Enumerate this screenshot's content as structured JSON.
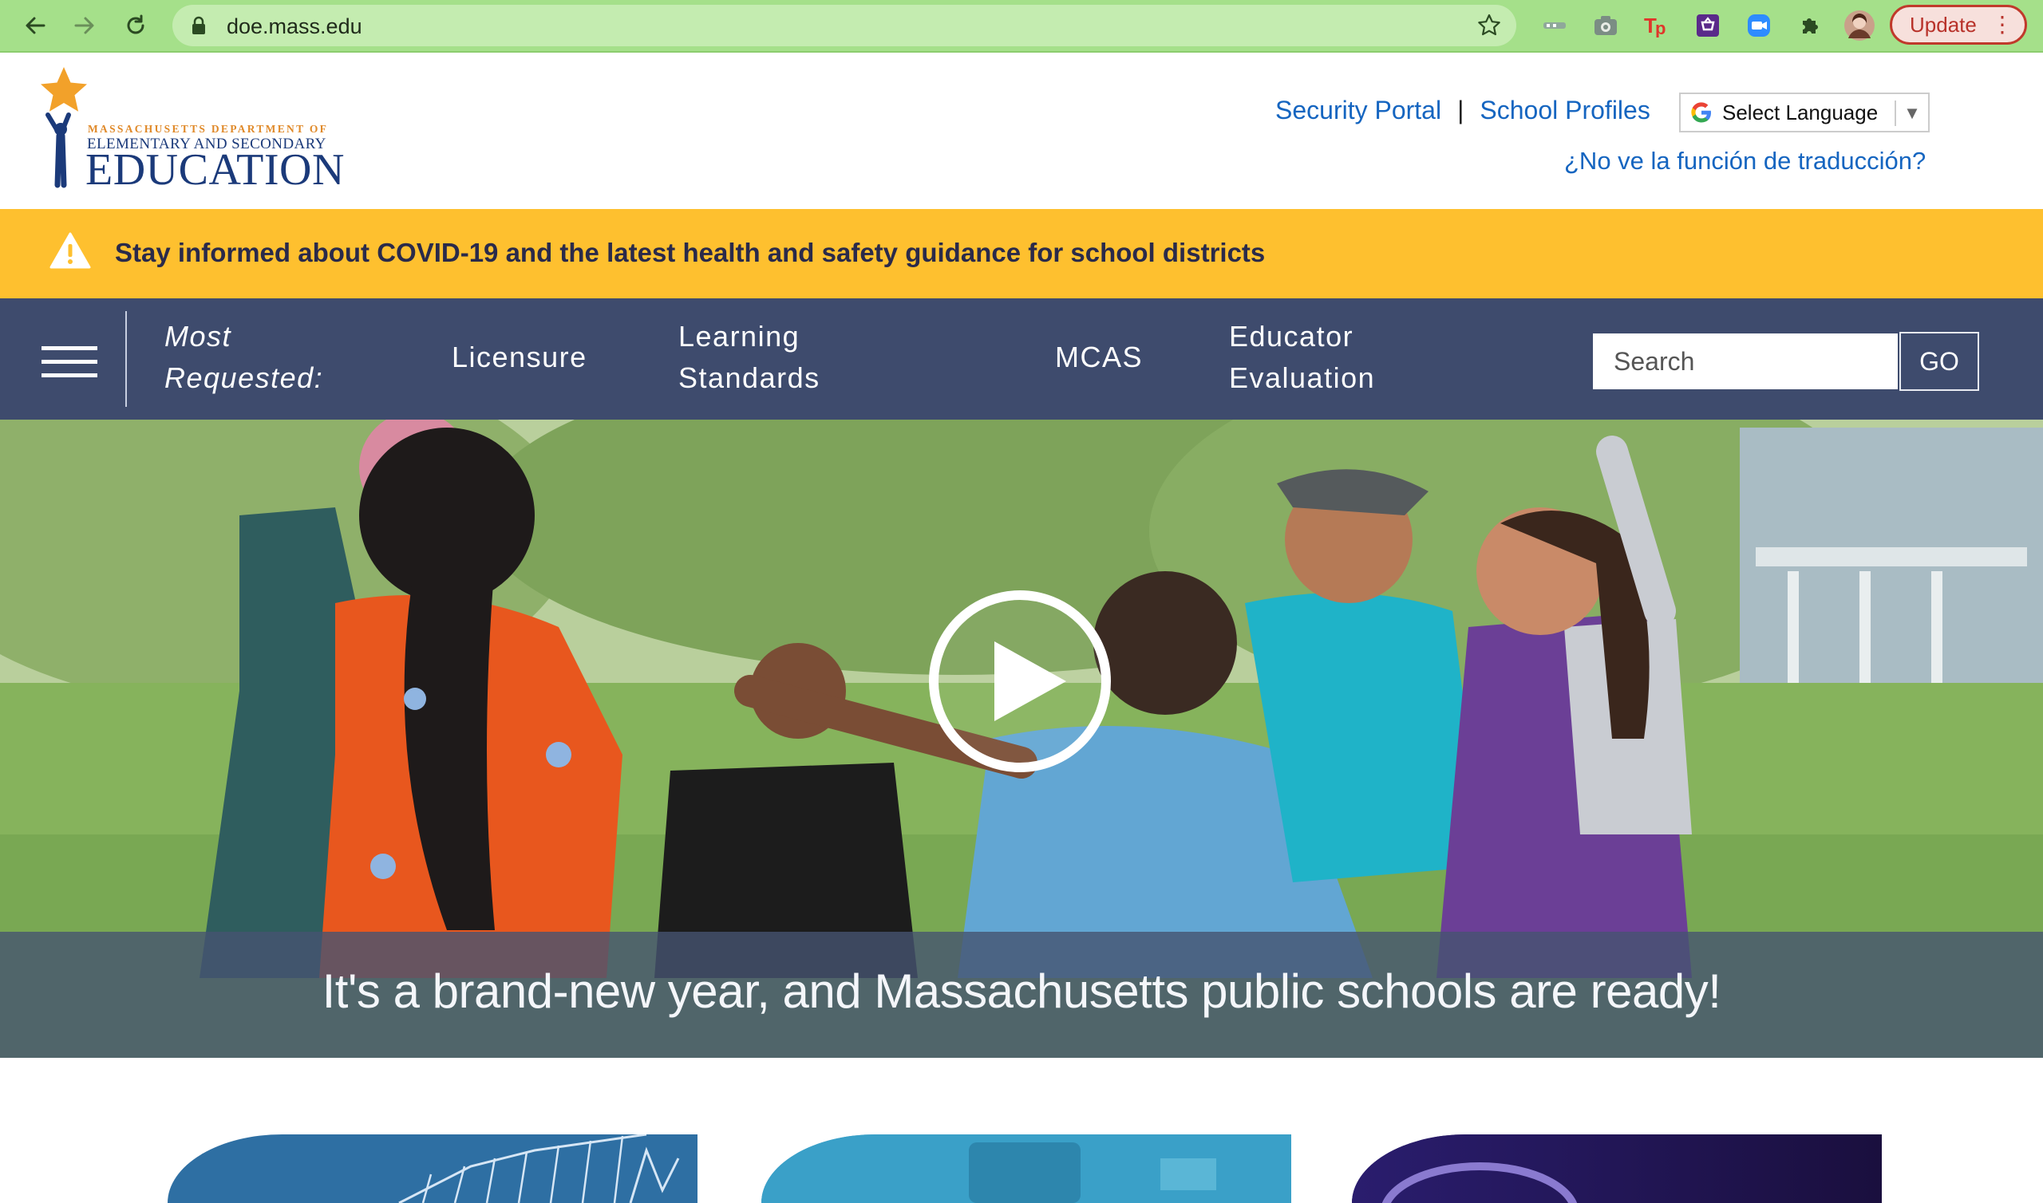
{
  "browser": {
    "url": "doe.mass.edu",
    "update_label": "Update",
    "extensions": [
      "key-icon",
      "camera-icon",
      "tp-icon",
      "shopping-icon",
      "zoom-icon",
      "puzzle-icon",
      "profile-avatar"
    ]
  },
  "logo": {
    "line1": "MASSACHUSETTS DEPARTMENT OF",
    "line2": "ELEMENTARY AND SECONDARY",
    "line3": "EDUCATION"
  },
  "header": {
    "links": [
      "Security Portal",
      "School Profiles"
    ],
    "separator": "|",
    "language_select": "Select Language",
    "translate_link": "¿No ve la función de traducción?"
  },
  "alert": {
    "text": "Stay informed about COVID-19 and the latest health and safety guidance for school districts"
  },
  "nav": {
    "most_requested_line1": "Most",
    "most_requested_line2": "Requested:",
    "items": [
      {
        "line1": "Licensure",
        "line2": ""
      },
      {
        "line1": "Learning",
        "line2": "Standards"
      },
      {
        "line1": "MCAS",
        "line2": ""
      },
      {
        "line1": "Educator",
        "line2": "Evaluation"
      }
    ],
    "search_placeholder": "Search",
    "go_label": "GO"
  },
  "hero": {
    "caption": "It's a brand-new year, and Massachusetts public schools are ready!"
  },
  "colors": {
    "chrome": "#a5e08a",
    "alert": "#fec02f",
    "nav": "#3e4b6d",
    "link": "#1565c0",
    "logo_blue": "#1b3a7a",
    "logo_orange": "#e08a2a"
  }
}
